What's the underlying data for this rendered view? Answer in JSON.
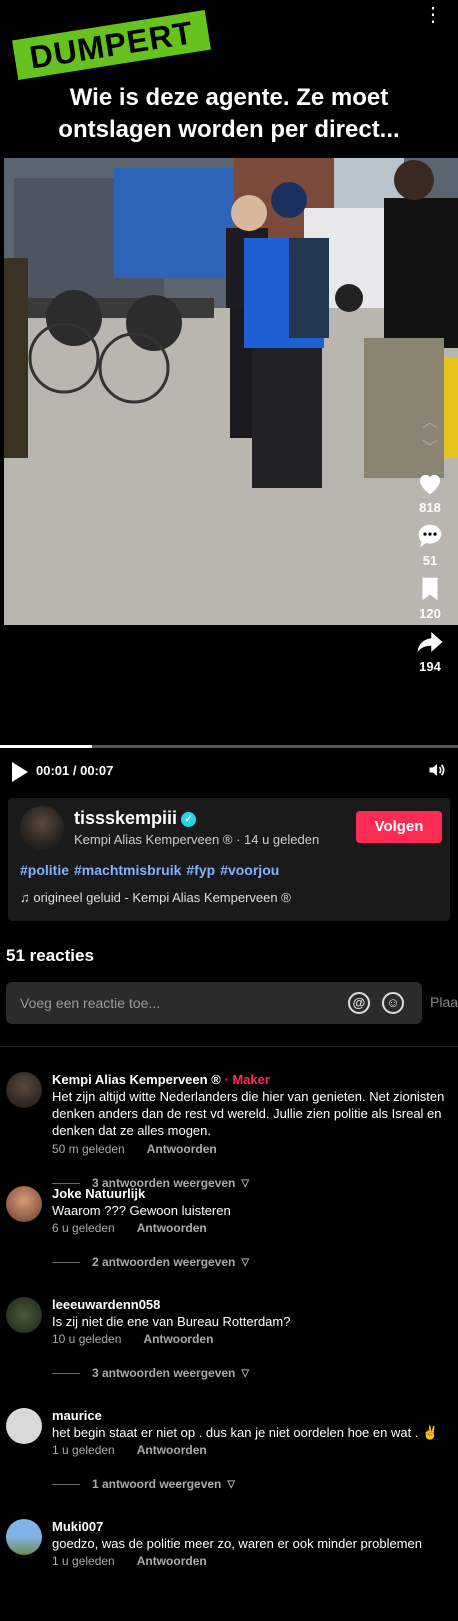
{
  "video": {
    "brand": "DUMPERT",
    "caption_line1": "Wie is deze agente. Ze moet",
    "caption_line2": "ontslagen worden per direct...",
    "progress_fraction": 0.2,
    "actions": [
      {
        "icon": "heart-icon",
        "count": "818"
      },
      {
        "icon": "comment-bubble-icon",
        "count": "51"
      },
      {
        "icon": "bookmark-icon",
        "count": "120"
      },
      {
        "icon": "share-arrow-icon",
        "count": "194"
      }
    ]
  },
  "player": {
    "time": "00:01 / 00:07"
  },
  "author": {
    "username": "tissskempiii",
    "display_name": "Kempi Alias Kemperveen",
    "registered": "®",
    "posted": " · 14 u geleden",
    "follow_label": "Volgen",
    "hashtags": [
      "#politie",
      "#machtmisbruik",
      "#fyp",
      "#voorjou"
    ],
    "music": "♫ origineel geluid - Kempi Alias Kemperveen ®"
  },
  "comments_section": {
    "count_label": "51 reacties",
    "input_placeholder": "Voeg een reactie toe...",
    "post_label": "Plaa",
    "reply_label": "Antwoorden",
    "items": [
      {
        "name": "Kempi Alias Kemperveen ®",
        "badge": " · Maker",
        "text": "Het zijn altijd witte Nederlanders die hier van genieten. Net zionisten denken anders dan de rest vd wereld. Jullie zien politie als Isreal en denken dat ze alles mogen.",
        "time": "50 m geleden",
        "replies": "3 antwoorden weergeven"
      },
      {
        "name": "Joke Natuurlijk",
        "badge": "",
        "text": "Waarom ??? Gewoon luisteren",
        "time": "6 u geleden",
        "replies": "2 antwoorden weergeven"
      },
      {
        "name": "leeeuwardenn058",
        "badge": "",
        "text": "Is zij niet die ene van Bureau Rotterdam?",
        "time": "10 u geleden",
        "replies": "3 antwoorden weergeven"
      },
      {
        "name": "maurice",
        "badge": "",
        "text": "het begin staat er niet op . dus kan je niet oordelen hoe en wat . ✌️",
        "time": "1 u geleden",
        "replies": "1 antwoord weergeven"
      },
      {
        "name": "Muki007",
        "badge": "",
        "text": "goedzo, was de politie meer zo, waren er ook minder problemen",
        "time": "1 u geleden",
        "replies": ""
      }
    ]
  }
}
